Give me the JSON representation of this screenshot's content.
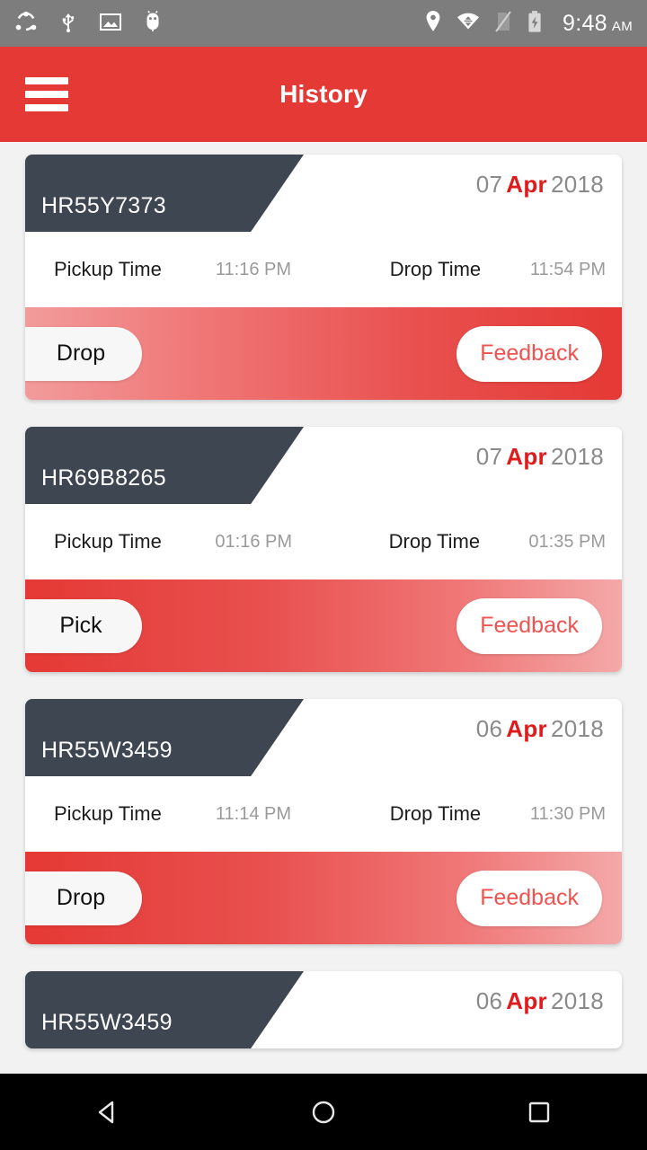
{
  "statusbar": {
    "left_icons": [
      "cast-screen-icon",
      "usb-icon",
      "screenshot-image-icon",
      "android-debug-bug-icon"
    ],
    "right_icons": [
      "location-pin-icon",
      "wifi-icon",
      "no-sim-signal-icon",
      "battery-charging-icon"
    ],
    "time": "9:48",
    "ampm": "AM",
    "background": "#7d7d7d"
  },
  "appbar": {
    "title": "History",
    "menu_icon": "hamburger-menu-icon",
    "background": "#e53935"
  },
  "colors": {
    "accent_red": "#e53935",
    "month_red": "#e01b1b",
    "plate_dark": "#3e4651",
    "page_background": "#f2f2f2",
    "muted_text": "#9a9a9a"
  },
  "labels": {
    "pickup_time": "Pickup Time",
    "drop_time": "Drop Time",
    "feedback": "Feedback"
  },
  "trips": [
    {
      "vehicle": "HR55Y7373",
      "day": "07",
      "month": "Apr",
      "year": "2018",
      "pickup_time": "11:16 PM",
      "drop_time": "11:54 PM",
      "status": "Drop",
      "feedback": "Feedback",
      "gradient": "grad-ltr"
    },
    {
      "vehicle": "HR69B8265",
      "day": "07",
      "month": "Apr",
      "year": "2018",
      "pickup_time": "01:16 PM",
      "drop_time": "01:35 PM",
      "status": "Pick",
      "feedback": "Feedback",
      "gradient": "grad-rtl"
    },
    {
      "vehicle": "HR55W3459",
      "day": "06",
      "month": "Apr",
      "year": "2018",
      "pickup_time": "11:14 PM",
      "drop_time": "11:30 PM",
      "status": "Drop",
      "feedback": "Feedback",
      "gradient": "grad-rtl"
    },
    {
      "vehicle": "HR55W3459",
      "day": "06",
      "month": "Apr",
      "year": "2018",
      "pickup_time": "",
      "drop_time": "",
      "status": "",
      "feedback": "",
      "gradient": "grad-ltr",
      "partial": true
    }
  ],
  "navbar": {
    "back": "back-icon",
    "home": "home-icon",
    "recents": "recents-icon"
  }
}
